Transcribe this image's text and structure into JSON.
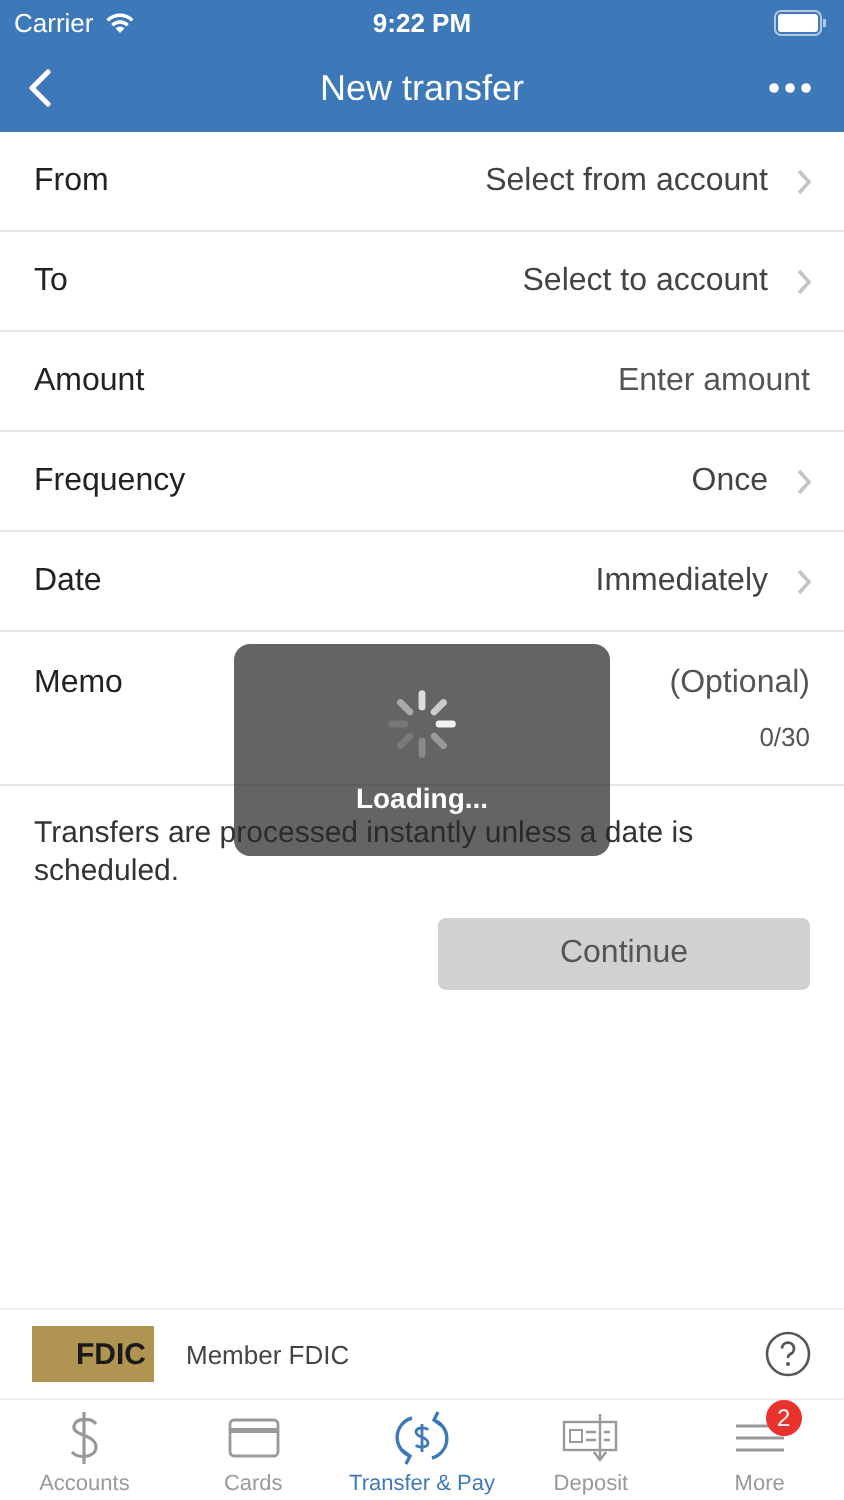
{
  "status_bar": {
    "carrier": "Carrier",
    "time": "9:22 PM"
  },
  "nav": {
    "title": "New transfer"
  },
  "fields": [
    {
      "kind": "select",
      "label": "From",
      "value": "Select from account"
    },
    {
      "kind": "select",
      "label": "To",
      "value": "Select to account"
    },
    {
      "kind": "input",
      "label": "Amount",
      "placeholder": "Enter amount"
    },
    {
      "kind": "select",
      "label": "Frequency",
      "value": "Once"
    },
    {
      "kind": "select",
      "label": "Date",
      "value": "Immediately"
    },
    {
      "kind": "memo",
      "label": "Memo",
      "placeholder": "(Optional)",
      "counter": "0/30"
    }
  ],
  "note": "Transfers are processed instantly unless a date is scheduled.",
  "continue_button": {
    "label": "Continue",
    "disabled": true
  },
  "loading": {
    "label": "Loading..."
  },
  "footer": {
    "logo": "FDIC",
    "text": "Member FDIC"
  },
  "tabs": [
    {
      "kind": "accounts",
      "label": "Accounts",
      "selected": false
    },
    {
      "kind": "cards",
      "label": "Cards",
      "selected": false
    },
    {
      "kind": "transfer",
      "label": "Transfer & Pay",
      "selected": true
    },
    {
      "kind": "deposit",
      "label": "Deposit",
      "selected": false
    },
    {
      "kind": "more",
      "label": "More",
      "selected": false,
      "badge": "2"
    }
  ]
}
